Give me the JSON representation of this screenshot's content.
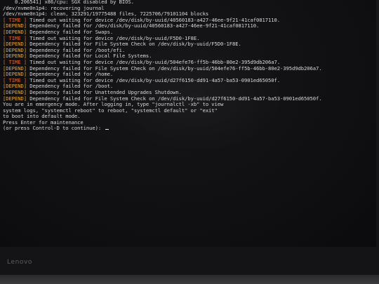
{
  "console": {
    "lines": [
      {
        "text": "    0.206541] x86/cpu: SGX disabled by BIOS."
      },
      {
        "text": "/dev/nvme0n1p4: recovering journal"
      },
      {
        "text": "/dev/nvme0n1p4: clean, 323291/19775488 files, 7225706/79101104 blocks"
      },
      {
        "tag": "[ TIME ]",
        "kind": "time",
        "text": " Timed out waiting for device /dev/disk/by-uuid/40560183-a427-46ee-9f21-41caf0817110."
      },
      {
        "tag": "[DEPEND]",
        "kind": "depend",
        "text": " Dependency failed for /dev/disk/by-uuid/40560183-a427-46ee-9f21-41caf0817110."
      },
      {
        "tag": "[DEPEND]",
        "kind": "depend",
        "text": " Dependency failed for Swaps."
      },
      {
        "tag": "[ TIME ]",
        "kind": "time",
        "text": " Timed out waiting for device /dev/disk/by-uuid/F5D0-1F8E."
      },
      {
        "tag": "[DEPEND]",
        "kind": "depend",
        "text": " Dependency failed for File System Check on /dev/disk/by-uuid/F5D0-1F8E."
      },
      {
        "tag": "[DEPEND]",
        "kind": "depend",
        "text": " Dependency failed for /boot/efi."
      },
      {
        "tag": "[DEPEND]",
        "kind": "depend",
        "text": " Dependency failed for Local File Systems."
      },
      {
        "tag": "[ TIME ]",
        "kind": "time",
        "text": " Timed out waiting for device /dev/disk/by-uuid/504efe76-ff5b-46bb-80e2-395d9db206a7."
      },
      {
        "tag": "[DEPEND]",
        "kind": "depend",
        "text": " Dependency failed for File System Check on /dev/disk/by-uuid/504efe76-ff5b-46bb-80e2-395d9db206a7."
      },
      {
        "tag": "[DEPEND]",
        "kind": "depend",
        "text": " Dependency failed for /home."
      },
      {
        "tag": "[ TIME ]",
        "kind": "time",
        "text": " Timed out waiting for device /dev/disk/by-uuid/d27f6150-dd91-4a57-ba53-0901ed65050f."
      },
      {
        "tag": "[DEPEND]",
        "kind": "depend",
        "text": " Dependency failed for /boot."
      },
      {
        "tag": "[DEPEND]",
        "kind": "depend",
        "text": " Dependency failed for Unattended Upgrades Shutdown."
      },
      {
        "tag": "[DEPEND]",
        "kind": "depend",
        "text": " Dependency failed for File System Check on /dev/disk/by-uuid/d27f6150-dd91-4a57-ba53-0901ed65050f."
      },
      {
        "text": "You are in emergency mode. After logging in, type \"journalctl -xb\" to view"
      },
      {
        "text": "system logs, \"systemctl reboot\" to reboot, \"systemctl default\" or \"exit\""
      },
      {
        "text": "to boot into default mode."
      },
      {
        "text": "Press Enter for maintenance"
      },
      {
        "text": "(or press Control-D to continue): ",
        "prompt": true
      }
    ]
  },
  "monitor": {
    "brand": "Lenovo"
  },
  "colors": {
    "time_tag": "#e06a3a",
    "depend_tag": "#e8a63a",
    "console_text": "#d8d8d8",
    "screen_bg": "#0f0f11"
  }
}
